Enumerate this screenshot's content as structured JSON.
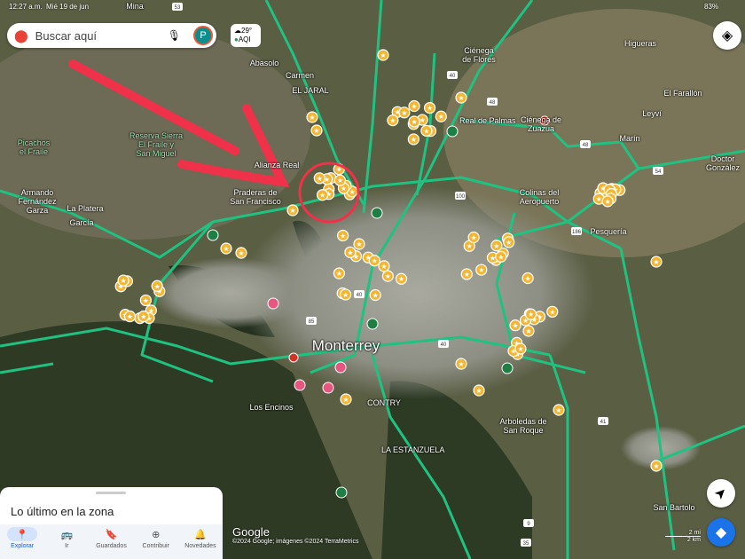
{
  "status_bar": {
    "time": "12:27 a.m.",
    "date": "Mié 19 de jun",
    "battery": "83%"
  },
  "search": {
    "placeholder": "Buscar aquí",
    "avatar_letter": "P"
  },
  "weather": {
    "temp": "29°",
    "aqi": "AQI"
  },
  "map_labels": {
    "mina": "Mina",
    "abasolo": "Abasolo",
    "carmen": "Carmen",
    "el_jaral": "EL JARAL",
    "cienega_flores": "Ciénega\nde Flores",
    "higueras": "Higueras",
    "el_farallon": "El Farallón",
    "leyvi": "Leyví",
    "real_palmas": "Real de Palmas",
    "cienega_zuazua": "Ciénega de\nZuazua",
    "marin": "Marín",
    "doctor_gonzalez": "Doctor\nGonzález",
    "colinas": "Colinas del\nAeropuerto",
    "pesqueria": "Pesquería",
    "picachos": "Picachos\nel Fraile",
    "reserva": "Reserva Sierra\nEl Fraile y\nSan Miguel",
    "alianza": "Alianza Real",
    "praderas": "Praderas de\nSan Francisco",
    "armando": "Armando\nFernández\nGarza",
    "la_platera": "La Platera",
    "garcia": "García",
    "monterrey": "Monterrey",
    "los_encinos": "Los Encinos",
    "contry": "CONTRY",
    "estanzuela": "LA ESTANZUELA",
    "arboledas": "Arboledas de\nSan Roque",
    "san_bartolo": "San Bartolo"
  },
  "road_shields": [
    "53",
    "40",
    "48",
    "48",
    "54",
    "100",
    "186",
    "85",
    "40",
    "40",
    "9",
    "35",
    "41"
  ],
  "bottom_sheet": {
    "title": "Lo último en la zona",
    "nav": [
      {
        "label": "Explorar",
        "icon": "location-pin-icon"
      },
      {
        "label": "Ir",
        "icon": "car-icon"
      },
      {
        "label": "Guardados",
        "icon": "bookmark-icon"
      },
      {
        "label": "Contribuir",
        "icon": "add-circle-icon"
      },
      {
        "label": "Novedades",
        "icon": "bell-icon"
      }
    ]
  },
  "attribution": {
    "logo": "Google",
    "copyright": "©2024 Google; imágenes ©2024 TerraMetrics"
  },
  "scale": {
    "mi": "2 mi",
    "km": "2 km"
  },
  "colors": {
    "road": "#1fc281",
    "marker": "#f2b632",
    "annotation": "#f0314a",
    "directions": "#1a73e8"
  }
}
